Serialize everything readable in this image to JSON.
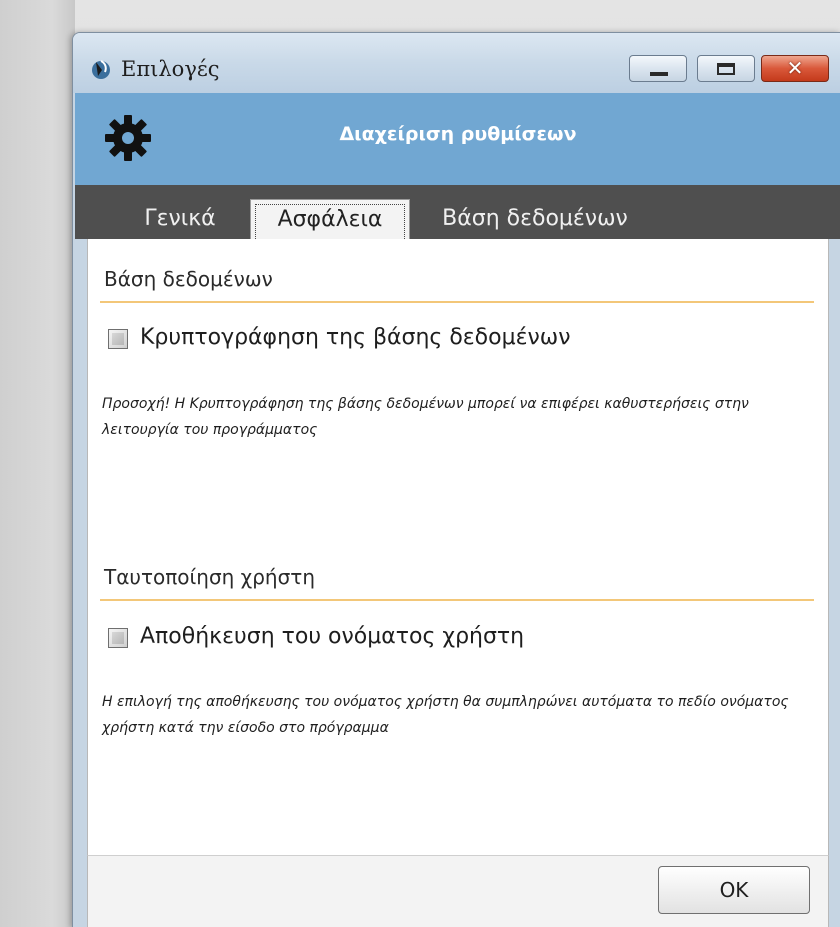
{
  "window": {
    "title": "Επιλογές",
    "controls": {
      "minimize_icon": "minimize-icon",
      "maximize_icon": "maximize-icon",
      "close_icon": "close-icon",
      "close_glyph": "✕"
    }
  },
  "header": {
    "title": "Διαχείριση ρυθμίσεων",
    "icon": "gear-icon",
    "background": "#71a7d2"
  },
  "tabs": [
    {
      "label": "Γενικά",
      "active": false
    },
    {
      "label": "Ασφάλεια",
      "active": true
    },
    {
      "label": "Βάση δεδομένων",
      "active": false
    }
  ],
  "sections": {
    "database": {
      "title": "Βάση δεδομένων",
      "checkbox_label": "Κρυπτογράφηση της βάσης δεδομένων",
      "checked": false,
      "note": "Προσοχή! Η Κρυπτογράφηση της βάσης δεδομένων μπορεί να επιφέρει καθυστερήσεις στην λειτουργία του προγράμματος"
    },
    "auth": {
      "title": "Ταυτοποίηση χρήστη",
      "checkbox_label": "Αποθήκευση του ονόματος χρήστη",
      "checked": false,
      "note": "Η επιλογή της αποθήκευσης του ονόματος χρήστη θα συμπληρώνει αυτόματα το πεδίο ονόματος χρήστη κατά την είσοδο στο πρόγραμμα"
    }
  },
  "footer": {
    "ok_label": "OK"
  },
  "colors": {
    "accent_divider": "#f3c779",
    "tab_strip": "#4f4f4f",
    "close_button": "#d9583a"
  }
}
